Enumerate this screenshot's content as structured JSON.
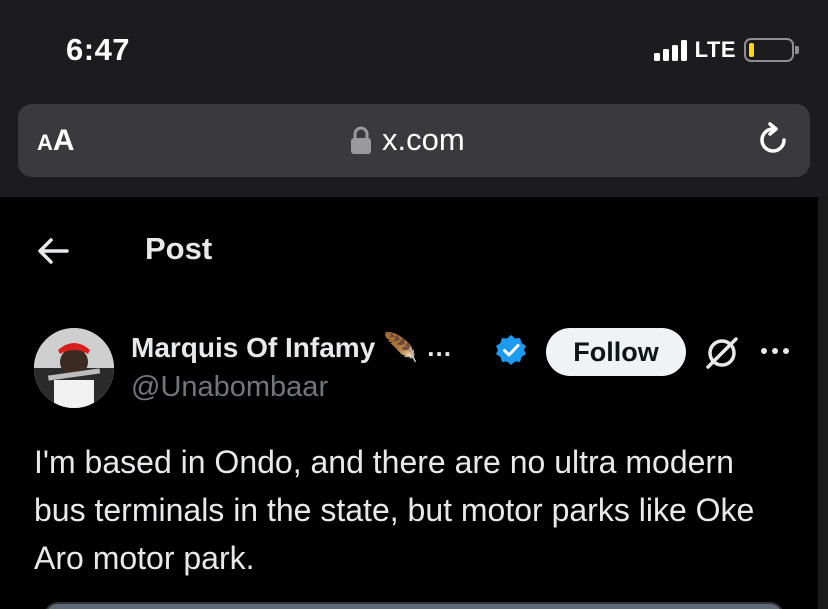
{
  "status_bar": {
    "time": "6:47",
    "network": "LTE",
    "battery_level": 0.1,
    "battery_color": "#ffd60a"
  },
  "browser": {
    "text_size_button": {
      "small": "A",
      "big": "A"
    },
    "url": "x.com",
    "lock_icon": "lock-icon",
    "reload_icon": "reload-icon"
  },
  "header": {
    "back_icon": "back-arrow-icon",
    "title": "Post"
  },
  "post": {
    "author": {
      "display_name": "Marquis Of Infamy",
      "name_emoji": "🪶",
      "name_truncation": "…",
      "handle": "@Unabombaar",
      "verified": true,
      "verified_color": "#1d9bf0"
    },
    "follow_label": "Follow",
    "text": "I'm based in Ondo, and there are no ultra modern bus terminals in the state, but motor parks like Oke Aro motor park."
  },
  "colors": {
    "background": "#000000",
    "browser_chrome": "#1c1c1e",
    "url_bar": "#3a3a3c",
    "primary_text": "#e7e9ea",
    "secondary_text": "#71767b",
    "follow_bg": "#eff3f4"
  }
}
